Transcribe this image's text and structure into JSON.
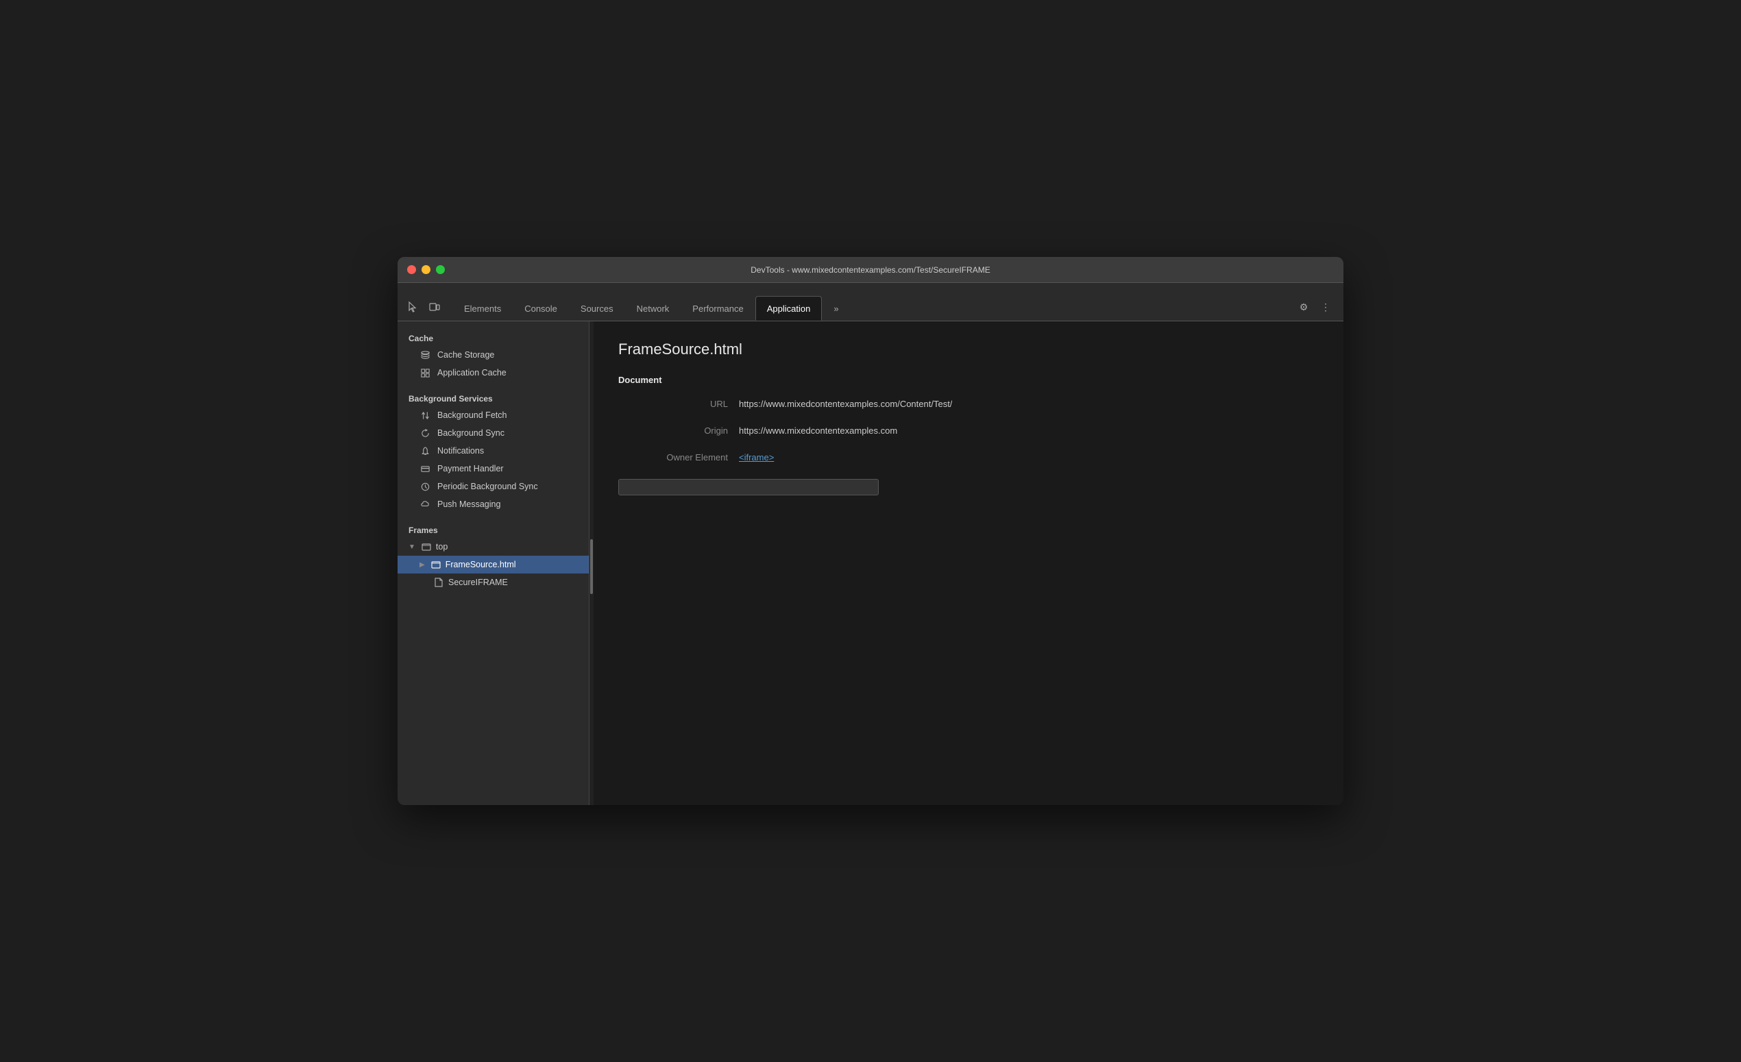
{
  "window": {
    "title": "DevTools - www.mixedcontentexamples.com/Test/SecureIFRAME"
  },
  "tabbar": {
    "icons": {
      "cursor": "⊹",
      "layers": "⧉"
    },
    "tabs": [
      {
        "label": "Elements",
        "active": false
      },
      {
        "label": "Console",
        "active": false
      },
      {
        "label": "Sources",
        "active": false
      },
      {
        "label": "Network",
        "active": false
      },
      {
        "label": "Performance",
        "active": false
      },
      {
        "label": "Application",
        "active": true
      }
    ],
    "more": "»",
    "settings": "⚙",
    "menu": "⋮"
  },
  "sidebar": {
    "cache_section": "Cache",
    "cache_items": [
      {
        "label": "Cache Storage",
        "icon": "db"
      },
      {
        "label": "Application Cache",
        "icon": "grid"
      }
    ],
    "background_section": "Background Services",
    "background_items": [
      {
        "label": "Background Fetch",
        "icon": "arrows"
      },
      {
        "label": "Background Sync",
        "icon": "sync"
      },
      {
        "label": "Notifications",
        "icon": "bell"
      },
      {
        "label": "Payment Handler",
        "icon": "card"
      },
      {
        "label": "Periodic Background Sync",
        "icon": "clock"
      },
      {
        "label": "Push Messaging",
        "icon": "cloud"
      }
    ],
    "frames_section": "Frames",
    "frames": {
      "top": "top",
      "frame_source": "FrameSource.html",
      "secure_iframe": "SecureIFRAME"
    }
  },
  "panel": {
    "title": "FrameSource.html",
    "document_label": "Document",
    "url_key": "URL",
    "url_value": "https://www.mixedcontentexamples.com/Content/Test/",
    "origin_key": "Origin",
    "origin_value": "https://www.mixedcontentexamples.com",
    "owner_key": "Owner Element",
    "owner_value": "<iframe>"
  }
}
